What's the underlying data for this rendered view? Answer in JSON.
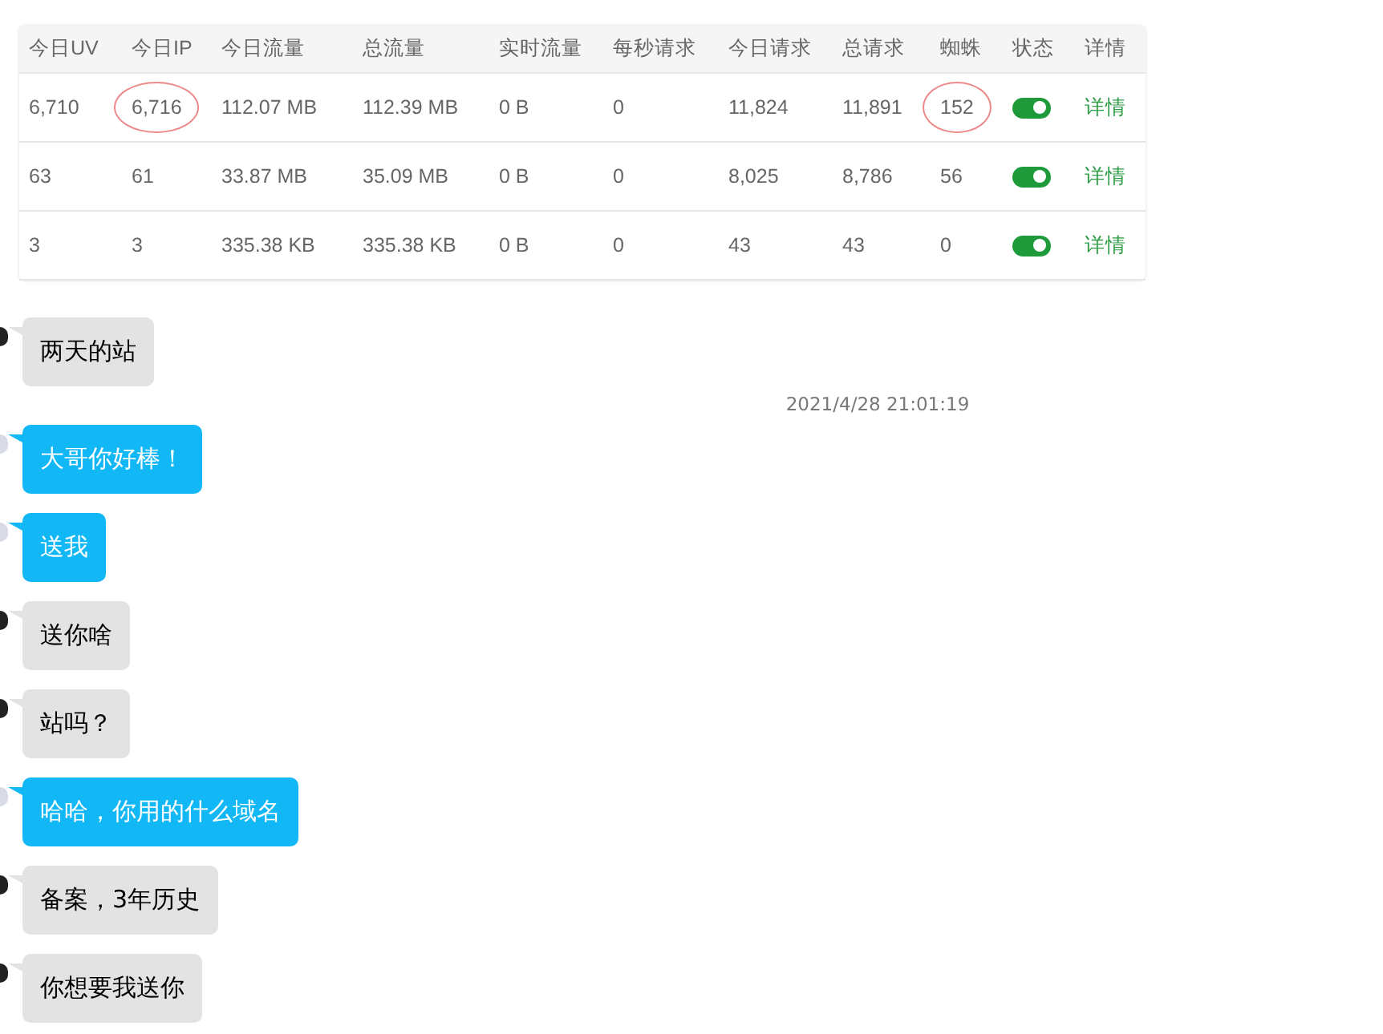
{
  "stats_table": {
    "columns": [
      "今日UV",
      "今日IP",
      "今日流量",
      "总流量",
      "实时流量",
      "每秒请求",
      "今日请求",
      "总请求",
      "蜘蛛",
      "状态",
      "详情"
    ],
    "rows": [
      {
        "cells": [
          {
            "text": "6,710",
            "circled": false
          },
          {
            "text": "6,716",
            "circled": true
          },
          {
            "text": "112.07 MB",
            "circled": false
          },
          {
            "text": "112.39 MB",
            "circled": false
          },
          {
            "text": "0 B",
            "circled": false
          },
          {
            "text": "0",
            "circled": false
          },
          {
            "text": "11,824",
            "circled": false
          },
          {
            "text": "11,891",
            "circled": false
          },
          {
            "text": "152",
            "circled": true
          }
        ],
        "on": true,
        "link": "详情"
      },
      {
        "cells": [
          {
            "text": "63",
            "circled": false
          },
          {
            "text": "61",
            "circled": false
          },
          {
            "text": "33.87 MB",
            "circled": false
          },
          {
            "text": "35.09 MB",
            "circled": false
          },
          {
            "text": "0 B",
            "circled": false
          },
          {
            "text": "0",
            "circled": false
          },
          {
            "text": "8,025",
            "circled": false
          },
          {
            "text": "8,786",
            "circled": false
          },
          {
            "text": "56",
            "circled": false
          }
        ],
        "on": true,
        "link": "详情"
      },
      {
        "cells": [
          {
            "text": "3",
            "circled": false
          },
          {
            "text": "3",
            "circled": false
          },
          {
            "text": "335.38 KB",
            "circled": false
          },
          {
            "text": "335.38 KB",
            "circled": false
          },
          {
            "text": "0 B",
            "circled": false
          },
          {
            "text": "0",
            "circled": false
          },
          {
            "text": "43",
            "circled": false
          },
          {
            "text": "43",
            "circled": false
          },
          {
            "text": "0",
            "circled": false
          }
        ],
        "on": true,
        "link": "详情"
      }
    ]
  },
  "messages": [
    {
      "kind": "received",
      "text": "两天的站"
    },
    {
      "kind": "time",
      "text": "2021/4/28 21:01:19"
    },
    {
      "kind": "sent",
      "text": "大哥你好棒！"
    },
    {
      "kind": "sent",
      "text": "送我"
    },
    {
      "kind": "received",
      "text": "送你啥"
    },
    {
      "kind": "received",
      "text": "站吗？"
    },
    {
      "kind": "sent",
      "text": "哈哈，你用的什么域名"
    },
    {
      "kind": "received",
      "text": "备案，3年历史"
    },
    {
      "kind": "received",
      "text": "你想要我送你"
    }
  ]
}
